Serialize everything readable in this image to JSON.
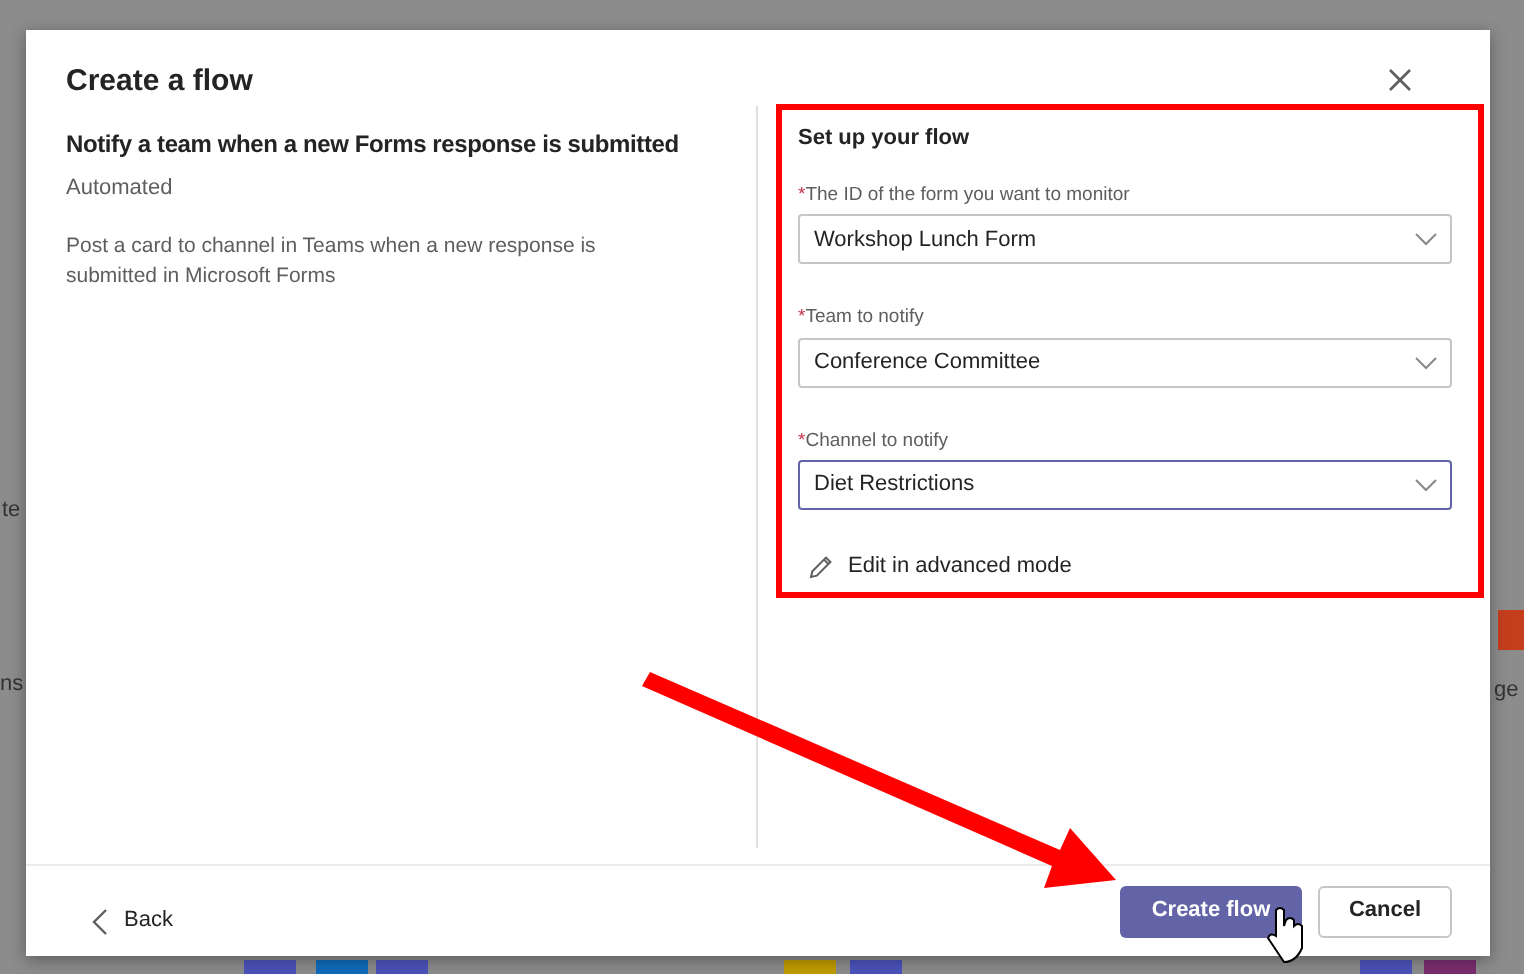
{
  "background_fragments": [
    {
      "text": "te"
    },
    {
      "text": "ns"
    },
    {
      "text": "ge"
    }
  ],
  "dialog": {
    "title": "Create a flow",
    "template": {
      "name": "Notify a team when a new Forms response is submitted",
      "type": "Automated",
      "description": "Post a card to channel in Teams when a new response is submitted in Microsoft Forms"
    },
    "setup": {
      "heading": "Set up your flow",
      "fields": [
        {
          "required_mark": "*",
          "label": "The ID of the form you want to monitor",
          "value": "Workshop Lunch Form",
          "focused": false
        },
        {
          "required_mark": "*",
          "label": "Team to notify",
          "value": "Conference Committee",
          "focused": false
        },
        {
          "required_mark": "*",
          "label": "Channel to notify",
          "value": "Diet Restrictions",
          "focused": true
        }
      ],
      "advanced_link": "Edit in advanced mode"
    },
    "back": "Back",
    "primary_button": "Create flow",
    "cancel_button": "Cancel"
  }
}
